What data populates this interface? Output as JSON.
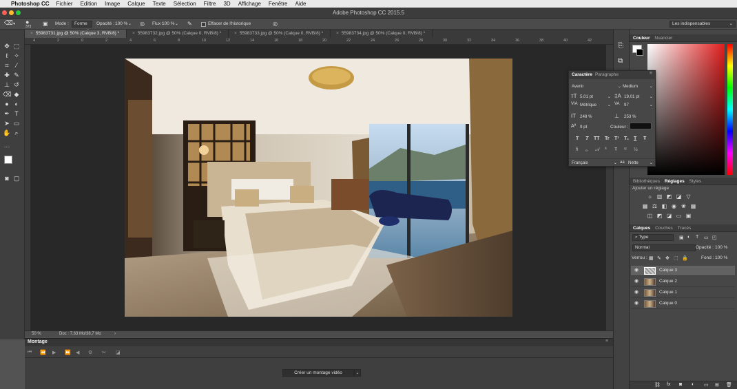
{
  "menubar": {
    "app": "Photoshop CC",
    "items": [
      "Fichier",
      "Edition",
      "Image",
      "Calque",
      "Texte",
      "Sélection",
      "Filtre",
      "3D",
      "Affichage",
      "Fenêtre",
      "Aide"
    ]
  },
  "window": {
    "title": "Adobe Photoshop CC 2015.5"
  },
  "options": {
    "brush_size": "373",
    "mode_label": "Mode :",
    "mode_value": "Forme",
    "opacity_label": "Opacité :",
    "opacity_value": "100 %",
    "flow_label": "Flux :",
    "flow_value": "100 %",
    "erase_history": "Effacer de l'historique",
    "workspace": "Les indispensables"
  },
  "tabs": [
    "55983731.jpg @ 50% (Calque 3, RVB/8) *",
    "55983732.jpg @ 50% (Calque 0, RVB/8) *",
    "55983733.jpg @ 50% (Calque 0, RVB/8) *",
    "55983734.jpg @ 50% (Calque 0, RVB/8) *"
  ],
  "ruler_top": [
    "4",
    "2",
    "0",
    "2",
    "4",
    "6",
    "8",
    "10",
    "12",
    "14",
    "16",
    "18",
    "20",
    "22",
    "24",
    "26",
    "28",
    "30",
    "32",
    "34",
    "36",
    "38",
    "40",
    "42"
  ],
  "status": {
    "zoom": "50 %",
    "doc": "Doc : 7,63 Mo/38,7 Mo"
  },
  "timeline": {
    "title": "Montage",
    "create_button": "Créer un montage vidéo"
  },
  "color_panel": {
    "tabs": [
      "Couleur",
      "Nuancier"
    ]
  },
  "character_panel": {
    "tabs": [
      "Caractère",
      "Paragraphe"
    ],
    "font_family": "Avenir",
    "font_style": "Medium",
    "size": "5,01 pt",
    "leading": "19,01 pt",
    "kerning": "Métrique",
    "tracking": "97",
    "vertical_scale": "248 %",
    "horizontal_scale": "253 %",
    "baseline": "9 pt",
    "color_label": "Couleur :",
    "style_buttons": [
      "T",
      "T",
      "TT",
      "Tr",
      "T¹",
      "T₁",
      "T",
      "Ŧ"
    ],
    "language": "Français",
    "antialias": "Nette",
    "antialias_icon": "aa"
  },
  "adjustments": {
    "tabs": [
      "Bibliothèques",
      "Réglages",
      "Styles"
    ],
    "add_label": "Ajouter un réglage"
  },
  "layers_panel": {
    "tabs": [
      "Calques",
      "Couches",
      "Tracés"
    ],
    "filter": "Type",
    "blend_mode": "Normal",
    "opacity_label": "Opacité :",
    "opacity_value": "100 %",
    "lock_label": "Verrou :",
    "fill_label": "Fond :",
    "fill_value": "100 %",
    "layers": [
      {
        "name": "Calque 3",
        "selected": true
      },
      {
        "name": "Calque 2",
        "selected": false
      },
      {
        "name": "Calque 1",
        "selected": false
      },
      {
        "name": "Calque 0",
        "selected": false
      }
    ],
    "footer_icons": [
      "fx"
    ]
  }
}
